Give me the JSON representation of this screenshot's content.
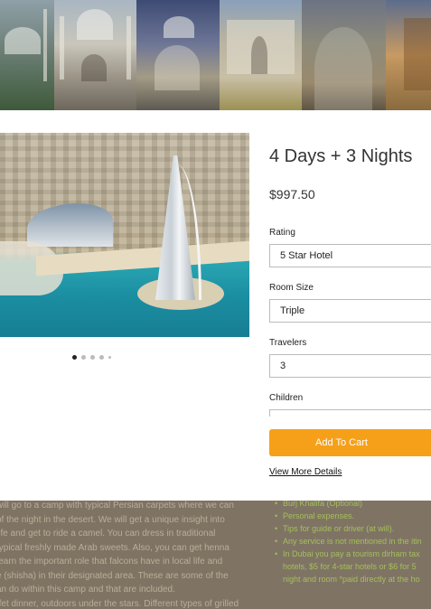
{
  "product": {
    "title": "4 Days + 3 Nights",
    "price": "$997.50",
    "rating_label": "Rating",
    "rating_value": "5 Star Hotel",
    "room_label": "Room Size",
    "room_value": "Triple",
    "travelers_label": "Travelers",
    "travelers_value": "3",
    "children_label": "Children",
    "children_value": "",
    "add_to_cart": "Add To Cart",
    "view_more": "View More Details"
  },
  "gallery": {
    "dot_count": 5,
    "active_dot": 0
  },
  "colors": {
    "accent": "#f6a01a",
    "list_text": "#a6bf5a",
    "body_text": "#b9ae98"
  },
  "description_lines": [
    "will go to a camp with typical Persian carpets where we can",
    "of the night in the desert. We will get a unique insight into",
    " life and get to ride a camel. You can dress in traditional",
    " typical freshly made Arab sweets. Also, you can get henna",
    " learn the important role that falcons have in local life and",
    "e (shisha) in their designated area. These are some of the",
    "an do within this camp and that are included.",
    "ffet dinner, outdoors under the stars. Different types of grilled"
  ],
  "not_included": [
    "Burj Khalifa (Optional)",
    "Personal expenses.",
    "Tips for guide or driver (at will).",
    "Any service is not mentioned in the itin",
    "In Dubai you pay a tourism dirham tax",
    "hotels,    $5 for 4-star hotels or $6 for 5",
    "night and room *paid directly at the ho"
  ]
}
